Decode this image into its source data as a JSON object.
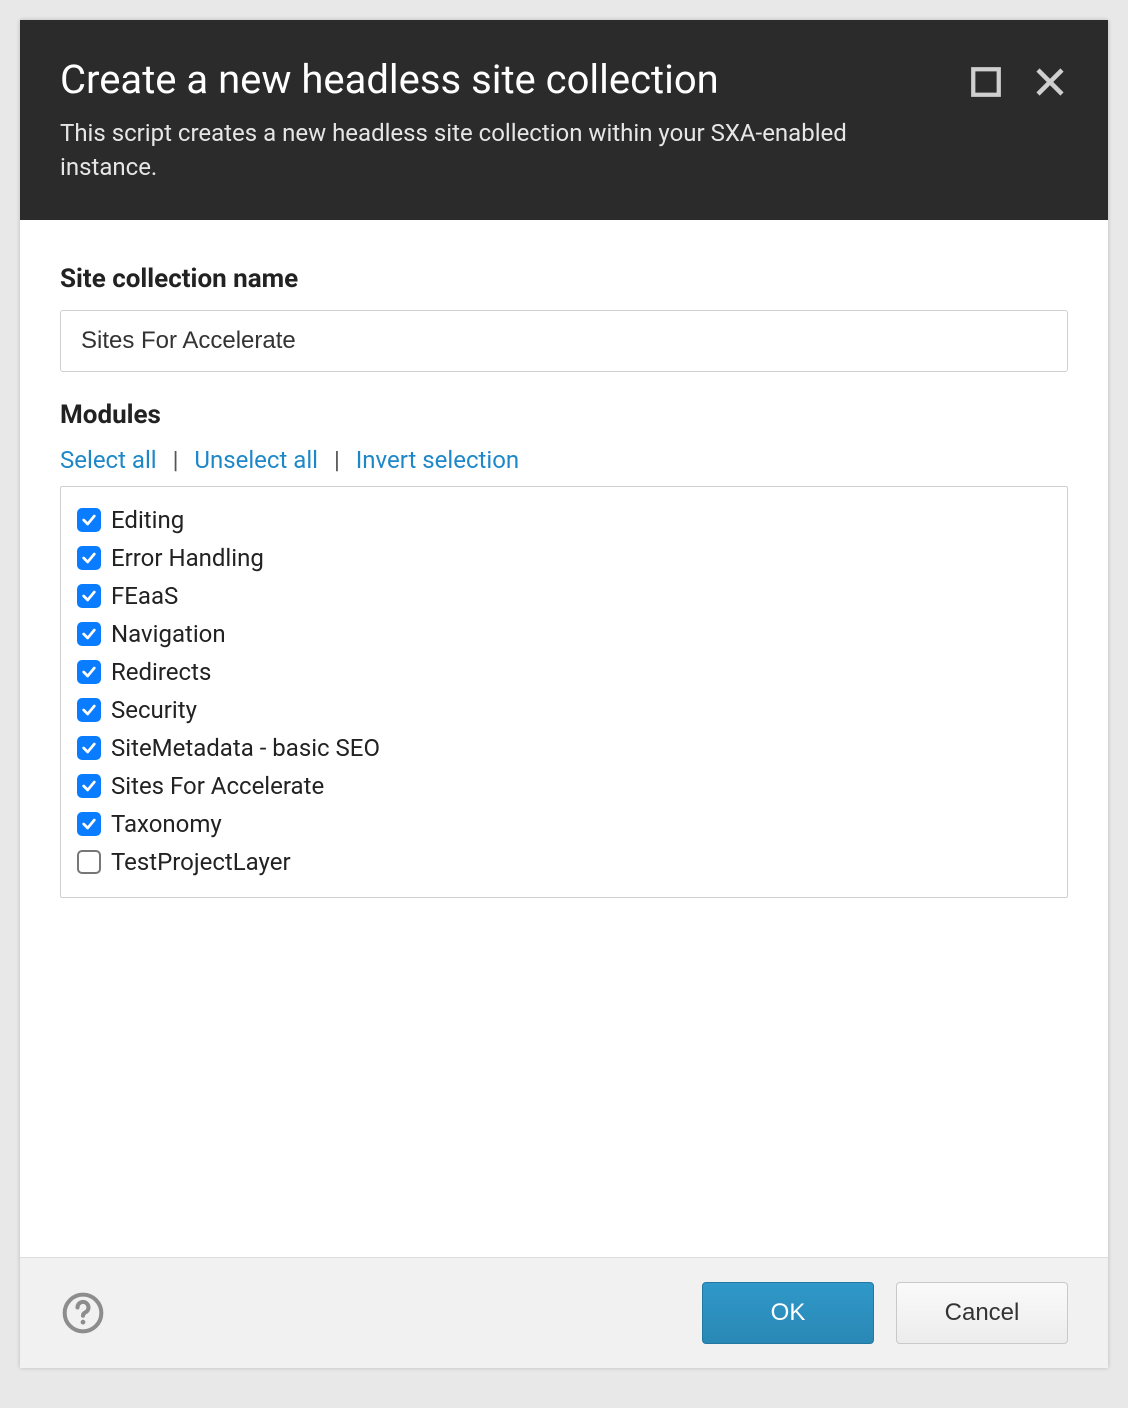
{
  "dialog": {
    "title": "Create a new headless site collection",
    "subtitle": "This script creates a new headless site collection within your SXA-enabled instance."
  },
  "form": {
    "site_collection_name_label": "Site collection name",
    "site_collection_name_value": "Sites For Accelerate",
    "modules_label": "Modules",
    "actions": {
      "select_all": "Select all",
      "unselect_all": "Unselect all",
      "invert_selection": "Invert selection"
    },
    "modules": [
      {
        "label": "Editing",
        "checked": true
      },
      {
        "label": "Error Handling",
        "checked": true
      },
      {
        "label": "FEaaS",
        "checked": true
      },
      {
        "label": "Navigation",
        "checked": true
      },
      {
        "label": "Redirects",
        "checked": true
      },
      {
        "label": "Security",
        "checked": true
      },
      {
        "label": "SiteMetadata - basic SEO",
        "checked": true
      },
      {
        "label": "Sites For Accelerate",
        "checked": true
      },
      {
        "label": "Taxonomy",
        "checked": true
      },
      {
        "label": "TestProjectLayer",
        "checked": false
      }
    ]
  },
  "footer": {
    "ok_label": "OK",
    "cancel_label": "Cancel"
  }
}
